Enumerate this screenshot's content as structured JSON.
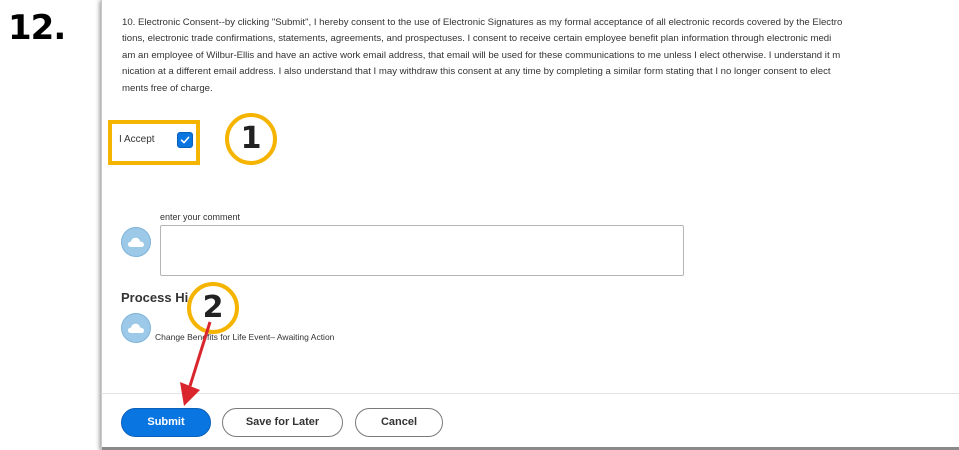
{
  "step": {
    "number": "12."
  },
  "consent": {
    "lines": [
      "10. Electronic Consent--by clicking \"Submit\", I hereby consent to the use of Electronic Signatures as my formal acceptance of all electronic records covered by the Electro",
      "tions, electronic trade confirmations, statements, agreements, and prospectuses.  I consent to receive certain employee benefit plan information through electronic medi",
      "am an employee of Wilbur-Ellis and have an active work email address, that email will be used for these communications to me unless I elect otherwise.  I understand it m",
      "nication at a different email address.  I also understand that I may withdraw this consent at any time by completing a similar form stating that I no longer consent to elect",
      "ments free of charge."
    ]
  },
  "accept": {
    "label": "I Accept",
    "checked": true
  },
  "callouts": {
    "one": "1",
    "two": "2"
  },
  "comment": {
    "label": "enter your comment",
    "value": ""
  },
  "process_history": {
    "title": "Process Hi",
    "item": "Change Benefits for Life Event– Awaiting Action"
  },
  "buttons": {
    "submit": "Submit",
    "save_later": "Save for Later",
    "cancel": "Cancel"
  },
  "colors": {
    "accent": "#0875e1",
    "highlight": "#f5b400",
    "arrow": "#d9262c",
    "avatar": "#9cc9e8"
  },
  "icons": {
    "avatar": "cloud-icon",
    "checkbox": "checkmark-icon"
  }
}
